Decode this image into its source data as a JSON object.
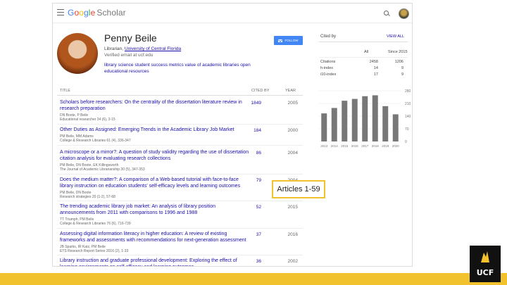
{
  "header": {
    "logo_google": [
      "G",
      "o",
      "o",
      "g",
      "l",
      "e"
    ],
    "logo_scholar": "Scholar",
    "icons": [
      "menu-icon",
      "search-icon",
      "account-avatar"
    ]
  },
  "profile": {
    "name": "Penny Beile",
    "affiliation_role": "Librarian,",
    "affiliation_org": "University of Central Florida",
    "verified": "Verified email at ucf.edu",
    "interests": "library science   student success metrics   value of academic libraries   open educational resources",
    "follow_label": "FOLLOW"
  },
  "table": {
    "title_header": "TITLE",
    "cited_header": "CITED BY",
    "year_header": "YEAR",
    "articles": [
      {
        "title": "Scholars before researchers: On the centrality of the dissertation literature review in research preparation",
        "authors": "DN Boote, P Beile",
        "venue": "Educational researcher 34 (6), 3-15",
        "cited_by": "1849",
        "year": "2005"
      },
      {
        "title": "Other Duties as Assigned: Emerging Trends in the Academic Library Job Market",
        "authors": "PM Beile, MM Adams",
        "venue": "College & Research Libraries 61 (4), 336-347",
        "cited_by": "184",
        "year": "2000"
      },
      {
        "title": "A microscope or a mirror?: A question of study validity regarding the use of dissertation citation analysis for evaluating research collections",
        "authors": "PM Beile, DN Boote, EK Killingsworth",
        "venue": "The Journal of Academic Librarianship 30 (5), 347-353",
        "cited_by": "86",
        "year": "2004"
      },
      {
        "title": "Does the medium matter?: A comparison of a Web-based tutorial with face-to-face library instruction on education students' self-efficacy levels and learning outcomes",
        "authors": "PM Beile, DN Boote",
        "venue": "Research strategies 20 (1-2), 57-68",
        "cited_by": "79",
        "year": "2004"
      },
      {
        "title": "The trending academic library job market: An analysis of library position announcements from 2011 with comparisons to 1996 and 1988",
        "authors": "TT Triumph, PM Beile",
        "venue": "College & Research Libraries 76 (6), 716-739",
        "cited_by": "52",
        "year": "2015"
      },
      {
        "title": "Assessing digital information literacy in higher education: A review of existing frameworks and assessments with recommendations for next-generation assessment",
        "authors": "JB Sparks, IR Katz, PM Beile",
        "venue": "ETS Research Report Series 2016 (2), 1-33",
        "cited_by": "37",
        "year": "2016"
      },
      {
        "title": "Library instruction and graduate professional development: Exploring the effect of learning environments on self-efficacy and learning outcomes",
        "authors": "",
        "venue": "",
        "cited_by": "36",
        "year": "2002"
      }
    ]
  },
  "cited_by": {
    "label": "Cited by",
    "view_all": "VIEW ALL",
    "col_all": "All",
    "col_since": "Since 2015",
    "rows": [
      {
        "metric": "Citations",
        "all": "2458",
        "since": "1206"
      },
      {
        "metric": "h-index",
        "all": "14",
        "since": "9"
      },
      {
        "metric": "i10-index",
        "all": "17",
        "since": "9"
      }
    ]
  },
  "chart_data": {
    "type": "bar",
    "categories": [
      "2013",
      "2014",
      "2015",
      "2016",
      "2017",
      "2018",
      "2019",
      "2020"
    ],
    "values": [
      155,
      185,
      225,
      235,
      250,
      255,
      195,
      150
    ],
    "yticks": [
      0,
      70,
      140,
      210,
      280
    ],
    "ylim": [
      0,
      280
    ],
    "grid": true,
    "bar_color": "#777777"
  },
  "badge": {
    "text": "Articles 1-59"
  },
  "branding": {
    "ucf_text": "UCF",
    "gold": "#f2c12e"
  }
}
